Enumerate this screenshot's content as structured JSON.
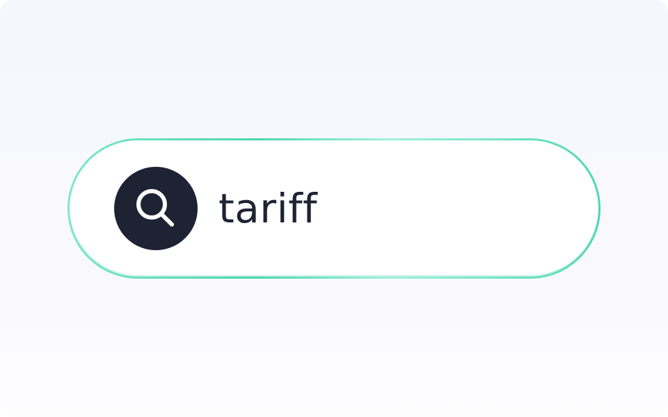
{
  "search": {
    "query": "tariff",
    "icon": "search-icon"
  },
  "colors": {
    "accent": "#49d6ab",
    "icon_bg": "#1d2333",
    "text": "#1d2333",
    "background": "#f7f7fd"
  }
}
